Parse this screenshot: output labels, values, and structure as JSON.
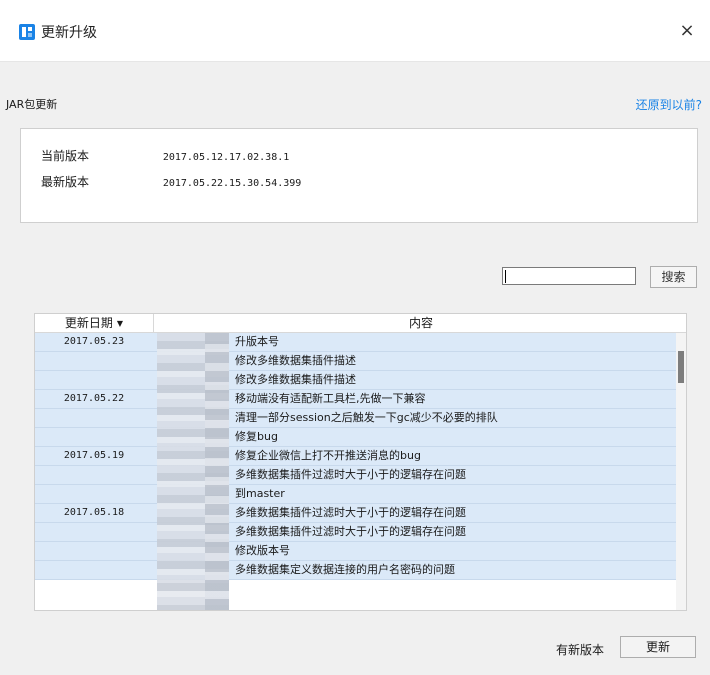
{
  "window": {
    "title": "更新升级",
    "close_label": "×",
    "accent": "#1a83e6"
  },
  "jar": {
    "section_label": "JAR包更新",
    "restore_link": "还原到以前?",
    "current_label": "当前版本",
    "current_value": "2017.05.12.17.02.38.1",
    "latest_label": "最新版本",
    "latest_value": "2017.05.22.15.30.54.399"
  },
  "search": {
    "value": "",
    "button_label": "搜索"
  },
  "table": {
    "col_date": "更新日期",
    "col_content": "内容",
    "sort_icon": "▼",
    "rows": [
      {
        "date": "2017.05.23",
        "content": "升版本号"
      },
      {
        "date": "",
        "content": "修改多维数据集插件描述"
      },
      {
        "date": "",
        "content": "修改多维数据集插件描述"
      },
      {
        "date": "2017.05.22",
        "content": "移动端没有适配新工具栏,先做一下兼容"
      },
      {
        "date": "",
        "content": "清理一部分session之后触发一下gc减少不必要的排队"
      },
      {
        "date": "",
        "content": "修复bug"
      },
      {
        "date": "2017.05.19",
        "content": "修复企业微信上打不开推送消息的bug"
      },
      {
        "date": "",
        "content": "多维数据集插件过滤时大于小于的逻辑存在问题"
      },
      {
        "date": "",
        "content": "到master"
      },
      {
        "date": "2017.05.18",
        "content": "多维数据集插件过滤时大于小于的逻辑存在问题"
      },
      {
        "date": "",
        "content": "多维数据集插件过滤时大于小于的逻辑存在问题"
      },
      {
        "date": "",
        "content": "修改版本号"
      },
      {
        "date": "",
        "content": "多维数据集定义数据连接的用户名密码的问题"
      }
    ]
  },
  "footer": {
    "status": "有新版本",
    "update_label": "更新"
  }
}
